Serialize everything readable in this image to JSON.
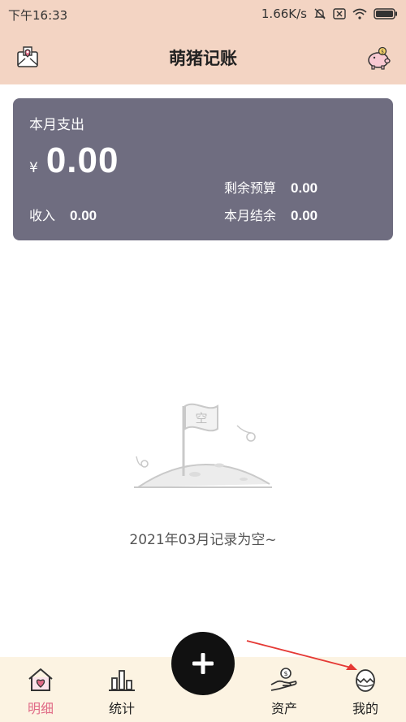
{
  "status_bar": {
    "time": "下午16:33",
    "network_speed": "1.66K/s",
    "icons": [
      "bell-off-icon",
      "sim-off-icon",
      "wifi-icon",
      "battery-icon"
    ]
  },
  "app_bar": {
    "title": "萌猪记账",
    "left_icon": "envelope-map-pin-icon",
    "right_icon": "piggy-bank-icon"
  },
  "summary_card": {
    "title": "本月支出",
    "currency": "¥",
    "expense": "0.00",
    "income_label": "收入",
    "income_value": "0.00",
    "budget_label": "剩余预算",
    "budget_value": "0.00",
    "balance_label": "本月结余",
    "balance_value": "0.00",
    "color": "#6f6d80"
  },
  "empty_state": {
    "flag_text": "空",
    "message": "2021年03月记录为空~"
  },
  "tab_bar": {
    "tabs": [
      {
        "label": "明细",
        "icon": "house-heart-icon",
        "active": true
      },
      {
        "label": "统计",
        "icon": "bar-chart-icon",
        "active": false
      },
      {
        "label": "资产",
        "icon": "hand-coin-icon",
        "active": false
      },
      {
        "label": "我的",
        "icon": "egg-icon",
        "active": false
      }
    ],
    "add_button_icon": "plus-icon",
    "accent_color": "#e06a86"
  }
}
